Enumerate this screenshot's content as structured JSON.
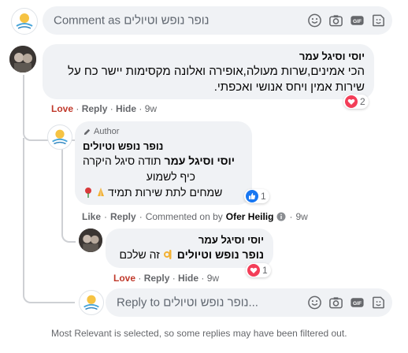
{
  "top_comment_box": {
    "placeholder": "Comment as נופר נופש וטיולים"
  },
  "comment": {
    "author": "יוסי וסיגל עמר",
    "text_line1": "הכי אמינים,שרות מעולה,אופירה ואלונה מקסימות יישר כח על",
    "text_line2": "שירות אמין ויחס אנושי ואכפתי.",
    "reactions_count": "2",
    "actions": {
      "love": "Love",
      "reply": "Reply",
      "hide": "Hide",
      "time": "9w"
    }
  },
  "reply1": {
    "badge": "Author",
    "author": "נופר נופש וטיולים",
    "mention": "יוסי וסיגל עמר",
    "text_line1": "תודה סיגל היקרה",
    "text_line2": "כיף לשמוע",
    "text_line3": "שמחים לתת שירות תמיד",
    "reactions_count": "1",
    "actions": {
      "like": "Like",
      "reply": "Reply",
      "commented_on_by": "Commented on by",
      "commenter": "Ofer Heilig",
      "time": "9w"
    }
  },
  "reply2": {
    "author": "יוסי וסיגל עמר",
    "mention": "נופר נופש וטיולים",
    "text": "זה שלכם",
    "reactions_count": "1",
    "actions": {
      "love": "Love",
      "reply": "Reply",
      "hide": "Hide",
      "time": "9w"
    }
  },
  "reply_box": {
    "placeholder": "Reply to נופר נופש וטיולים..."
  },
  "footer_note": "Most Relevant is selected, so some replies may have been filtered out.",
  "icons": [
    "emoji-icon",
    "camera-icon",
    "gif-icon",
    "sticker-icon",
    "heart-reaction-icon",
    "like-reaction-icon",
    "author-pencil-icon",
    "info-icon"
  ],
  "colors": {
    "love": "#c0392b",
    "like_blue": "#1877f2",
    "heart_red": "#f33e58",
    "bubble": "#f0f2f5",
    "muted": "#65676b"
  }
}
